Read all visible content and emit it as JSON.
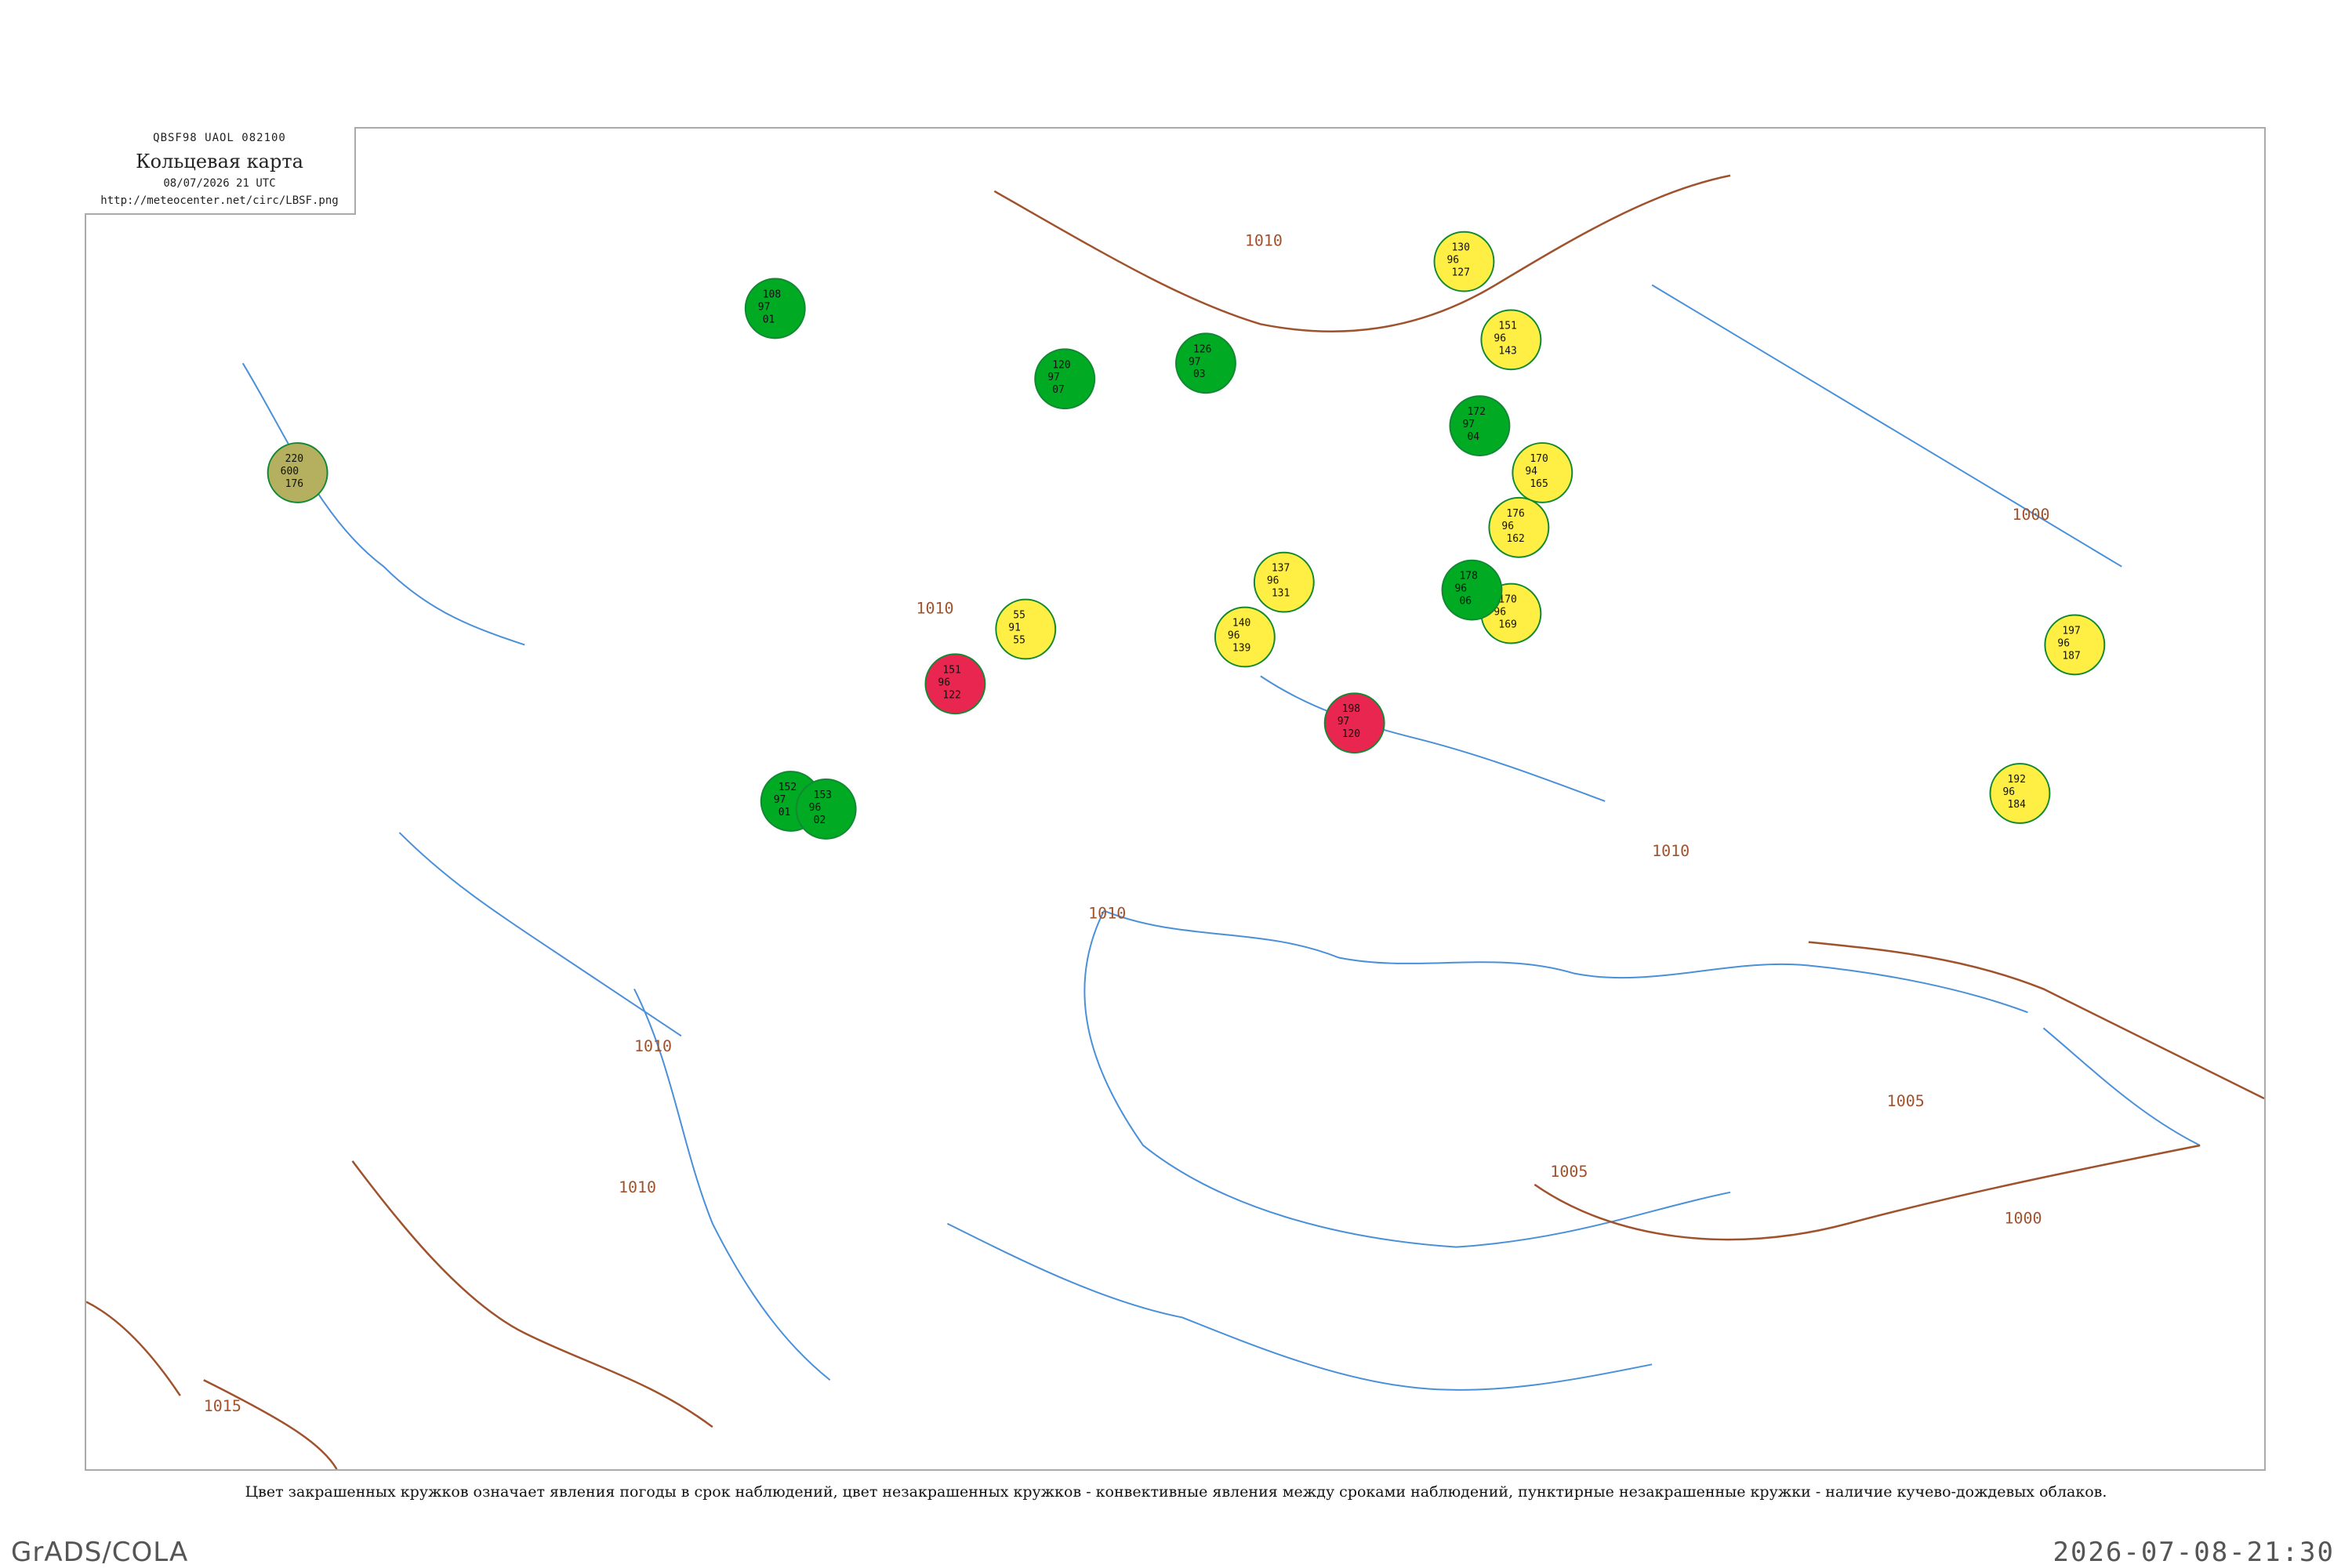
{
  "header": {
    "codes": "QBSF98  UAOL  082100",
    "title": "Кольцевая карта",
    "datetime": "08/07/2026 21 UTC",
    "url": "http://meteocenter.net/circ/LBSF.png"
  },
  "isobar_labels": [
    "1005",
    "1010",
    "1010",
    "1010",
    "1010",
    "1010",
    "1005",
    "1005",
    "1000",
    "1015",
    "1010",
    "1000"
  ],
  "stations": [
    {
      "id": "s1",
      "color": "green",
      "values": [
        "108",
        "97",
        "01"
      ]
    },
    {
      "id": "s2",
      "color": "green",
      "values": [
        "120",
        "97",
        "07"
      ]
    },
    {
      "id": "s3",
      "color": "green",
      "values": [
        "126",
        "97",
        "03"
      ]
    },
    {
      "id": "s4",
      "color": "yellow",
      "values": [
        "130",
        "96",
        "127"
      ]
    },
    {
      "id": "s5",
      "color": "yellow",
      "values": [
        "151",
        "96",
        "143"
      ]
    },
    {
      "id": "s6",
      "color": "yellow",
      "values": [
        "170",
        "94",
        "165"
      ]
    },
    {
      "id": "s7",
      "color": "yellow",
      "values": [
        "176",
        "96",
        "162"
      ]
    },
    {
      "id": "s8",
      "color": "yellow",
      "values": [
        "170",
        "96",
        "169"
      ]
    },
    {
      "id": "s9",
      "color": "red",
      "values": [
        "151",
        "96",
        "122"
      ]
    },
    {
      "id": "s10",
      "color": "red",
      "values": [
        "198",
        "97",
        "120"
      ]
    },
    {
      "id": "s11",
      "color": "yellow",
      "values": [
        "55",
        "91",
        "55"
      ]
    },
    {
      "id": "s12",
      "color": "yellow",
      "values": [
        "140",
        "96",
        "139"
      ]
    },
    {
      "id": "s13",
      "color": "yellow",
      "values": [
        "137",
        "96",
        "131"
      ]
    },
    {
      "id": "s14",
      "color": "yellow",
      "values": [
        "197",
        "96",
        "187"
      ]
    },
    {
      "id": "s15",
      "color": "yellow",
      "values": [
        "192",
        "96",
        "184"
      ]
    },
    {
      "id": "s16",
      "color": "olive",
      "values": [
        "220",
        "600",
        "176"
      ]
    },
    {
      "id": "s17",
      "color": "green",
      "values": [
        "152",
        "97",
        "01"
      ]
    },
    {
      "id": "s18",
      "color": "green",
      "values": [
        "153",
        "96",
        "02"
      ]
    },
    {
      "id": "s19",
      "color": "green",
      "values": [
        "172",
        "97",
        "04"
      ]
    },
    {
      "id": "s20",
      "color": "green",
      "values": [
        "178",
        "96",
        "06"
      ]
    }
  ],
  "caption": "Цвет закрашенных кружков означает явления погоды в срок наблюдений, цвет незакрашенных кружков - конвективные явления между сроками наблюдений, пунктирные незакрашенные кружки - наличие кучево-дождевых облаков.",
  "footer": {
    "left": "GrADS/COLA",
    "right": "2026-07-08-21:30"
  },
  "colors": {
    "isobar": "#a0522d",
    "water": "#4a90d9",
    "station_green": "#00aa22",
    "station_yellow": "#ffee44",
    "station_red": "#e8264f",
    "station_olive": "#b5b060"
  }
}
